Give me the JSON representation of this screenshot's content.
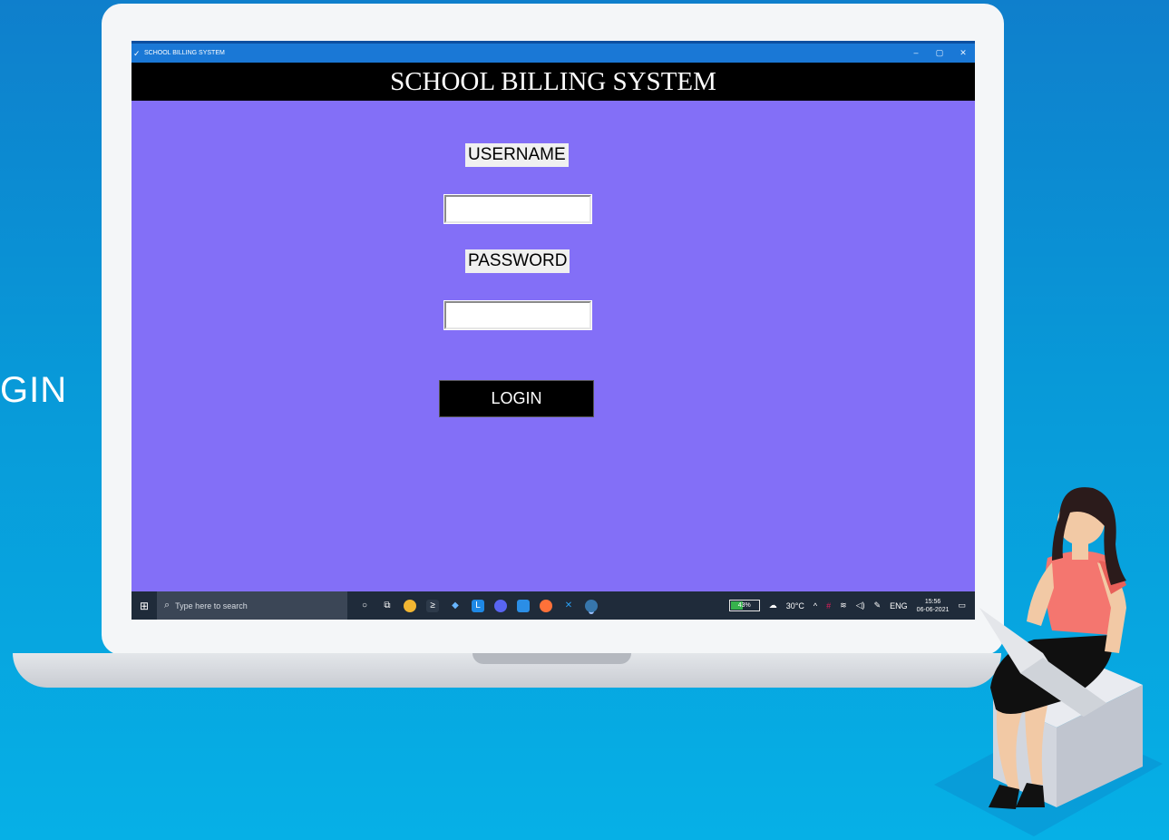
{
  "side_text": "GIN",
  "window": {
    "title": "SCHOOL BILLING SYSTEM",
    "controls": {
      "minimize": "–",
      "maximize": "▢",
      "close": "✕"
    }
  },
  "app": {
    "header": "SCHOOL BILLING SYSTEM",
    "username_label": "USERNAME",
    "username_value": "",
    "password_label": "PASSWORD",
    "password_value": "",
    "login_label": "LOGIN"
  },
  "taskbar": {
    "search_placeholder": "Type here to search",
    "battery": "43%",
    "battery_level": 0.43,
    "weather": "30°C",
    "language": "ENG",
    "time": "15:56",
    "date": "06-06-2021",
    "pinned_icons": [
      "cortana-icon",
      "task-view-icon",
      "chrome-icon",
      "terminal-icon",
      "vs-icon",
      "l-app-icon",
      "discord-icon",
      "mail-icon",
      "firefox-icon",
      "vscode-icon",
      "python-icon"
    ]
  },
  "colors": {
    "screen_bg": "#836ff7",
    "page_bg": "#0899d8",
    "header_bg": "#000000",
    "titlebar_bg": "#1a78d6"
  }
}
